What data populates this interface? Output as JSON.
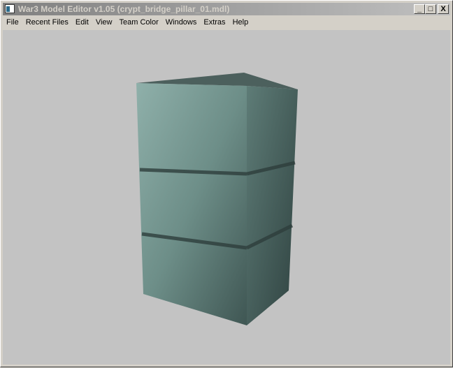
{
  "window": {
    "title": "War3 Model Editor v1.05 (crypt_bridge_pillar_01.mdl)",
    "controls": {
      "minimize": "_",
      "maximize": "□",
      "close": "X"
    }
  },
  "menu": [
    "File",
    "Recent Files",
    "Edit",
    "View",
    "Team Color",
    "Windows",
    "Extras",
    "Help"
  ],
  "viewport": {
    "background": "#c3c3c3",
    "model_color": "#6e8c86"
  }
}
